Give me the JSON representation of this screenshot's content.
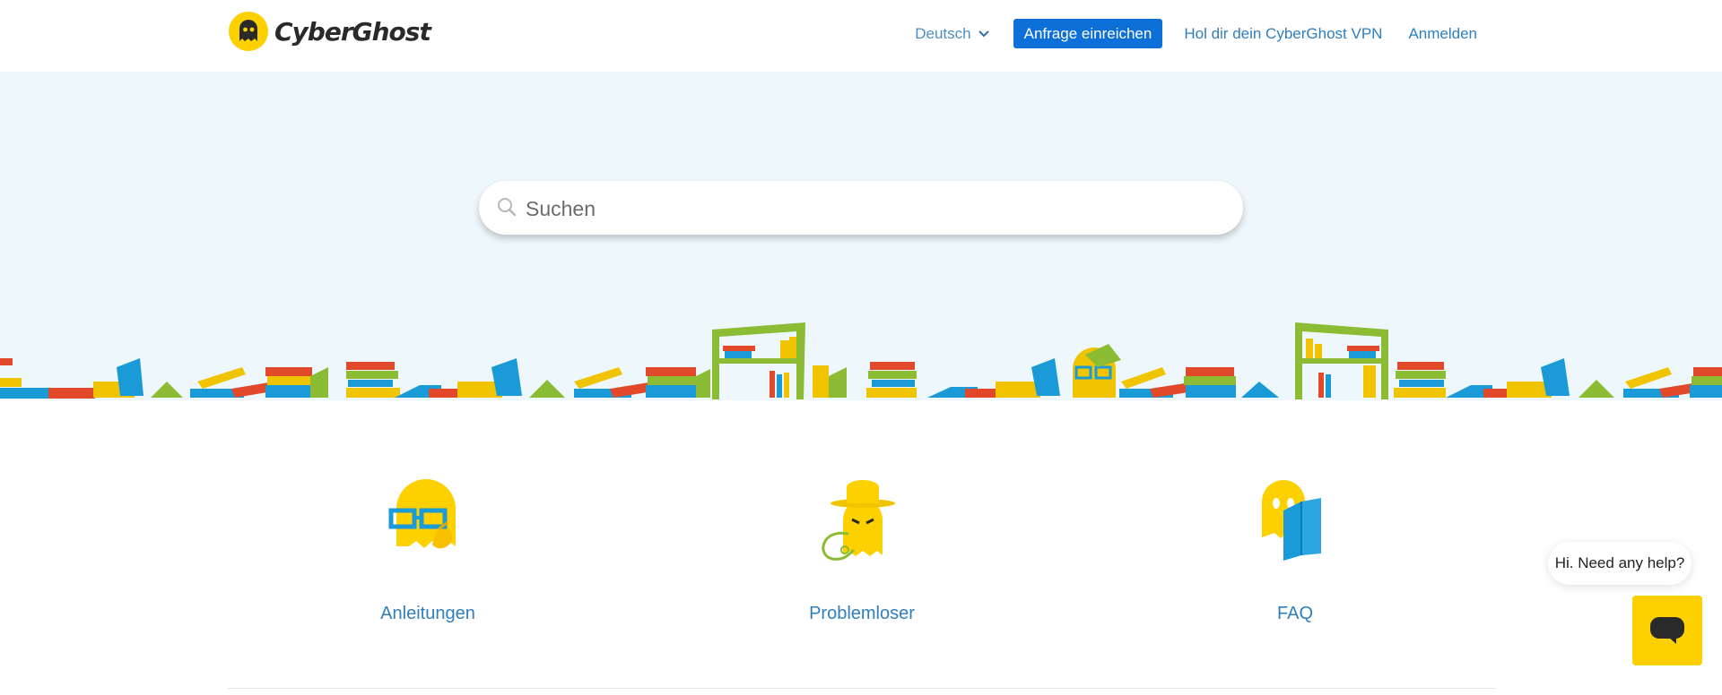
{
  "header": {
    "brand": "CyberGhost",
    "language": "Deutsch",
    "submit_request": "Anfrage einreichen",
    "get_vpn": "Hol dir dein CyberGhost VPN",
    "sign_in": "Anmelden"
  },
  "search": {
    "placeholder": "Suchen"
  },
  "categories": [
    {
      "label": "Anleitungen",
      "icon": "ghost-glasses-icon"
    },
    {
      "label": "Problemloser",
      "icon": "ghost-detective-icon"
    },
    {
      "label": "FAQ",
      "icon": "ghost-book-icon"
    }
  ],
  "chat": {
    "greeting": "Hi. Need any help?"
  },
  "colors": {
    "brand_yellow": "#FDD000",
    "primary_button": "#0D6FD8",
    "link": "#2F7FBD",
    "hero_bg": "#EEF7FB"
  }
}
